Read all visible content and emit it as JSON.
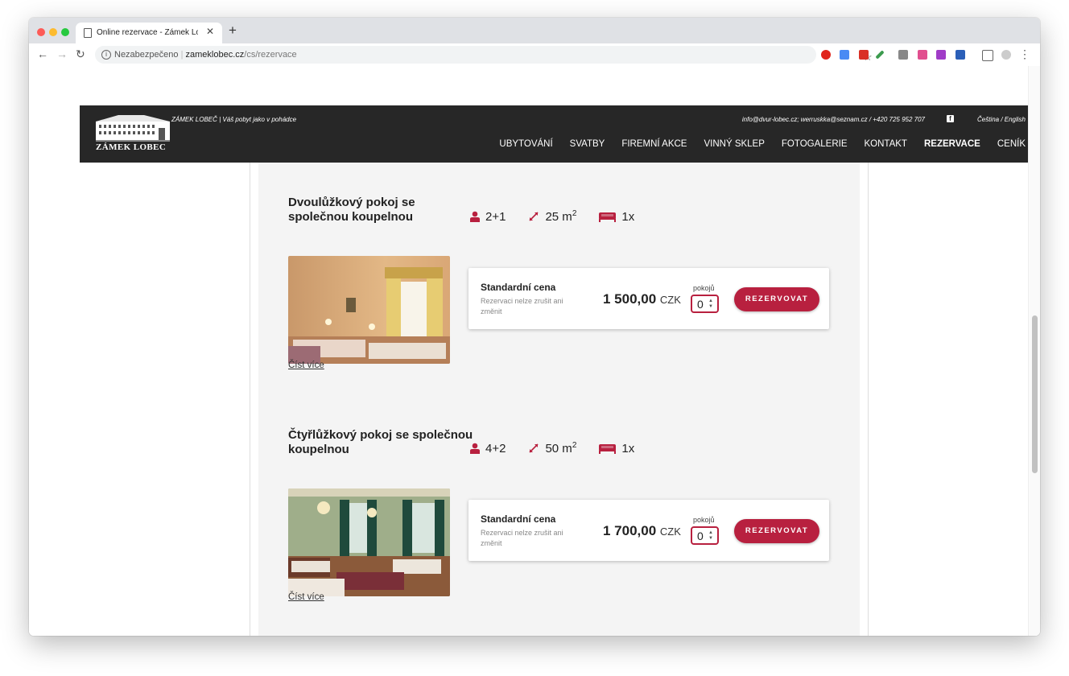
{
  "browser": {
    "tab_title": "Online rezervace - Zámek Lobec",
    "security_label": "Nezabezpečeno",
    "url_host": "zameklobec.cz",
    "url_path": "/cs/rezervace"
  },
  "site": {
    "logo_text": "ZÁMEK LOBEC",
    "tagline": "ZÁMEK LOBEČ  |  Váš pobyt jako v pohádce",
    "contact": "info@dvur-lobec.cz; werruskka@seznam.cz / +420 725 952 707",
    "languages": "Čeština / English",
    "nav": [
      {
        "label": "UBYTOVÁNÍ",
        "active": false
      },
      {
        "label": "SVATBY",
        "active": false
      },
      {
        "label": "FIREMNÍ AKCE",
        "active": false
      },
      {
        "label": "VINNÝ SKLEP",
        "active": false
      },
      {
        "label": "FOTOGALERIE",
        "active": false
      },
      {
        "label": "KONTAKT",
        "active": false
      },
      {
        "label": "REZERVACE",
        "active": true
      },
      {
        "label": "CENÍK",
        "active": false
      }
    ]
  },
  "rooms": [
    {
      "title": "Dvoulůžkový pokoj se společnou koupelnou",
      "guests": "2+1",
      "area": "25 m",
      "area_sup": "2",
      "beds": "1x",
      "read_more": "Číst více",
      "rate": {
        "name": "Standardní cena",
        "note": "Rezervaci nelze zrušit ani změnit",
        "price": "1 500,00",
        "currency": "CZK",
        "rooms_label": "pokojů",
        "qty": "0",
        "button": "REZERVOVAT"
      }
    },
    {
      "title": "Čtyřlůžkový pokoj se společnou koupelnou",
      "guests": "4+2",
      "area": "50 m",
      "area_sup": "2",
      "beds": "1x",
      "read_more": "Číst více",
      "rate": {
        "name": "Standardní cena",
        "note": "Rezervaci nelze zrušit ani změnit",
        "price": "1 700,00",
        "currency": "CZK",
        "rooms_label": "pokojů",
        "qty": "0",
        "button": "REZERVOVAT"
      }
    }
  ],
  "colors": {
    "accent": "#b8203f",
    "header_bg": "#272727",
    "content_bg": "#f4f4f4"
  }
}
